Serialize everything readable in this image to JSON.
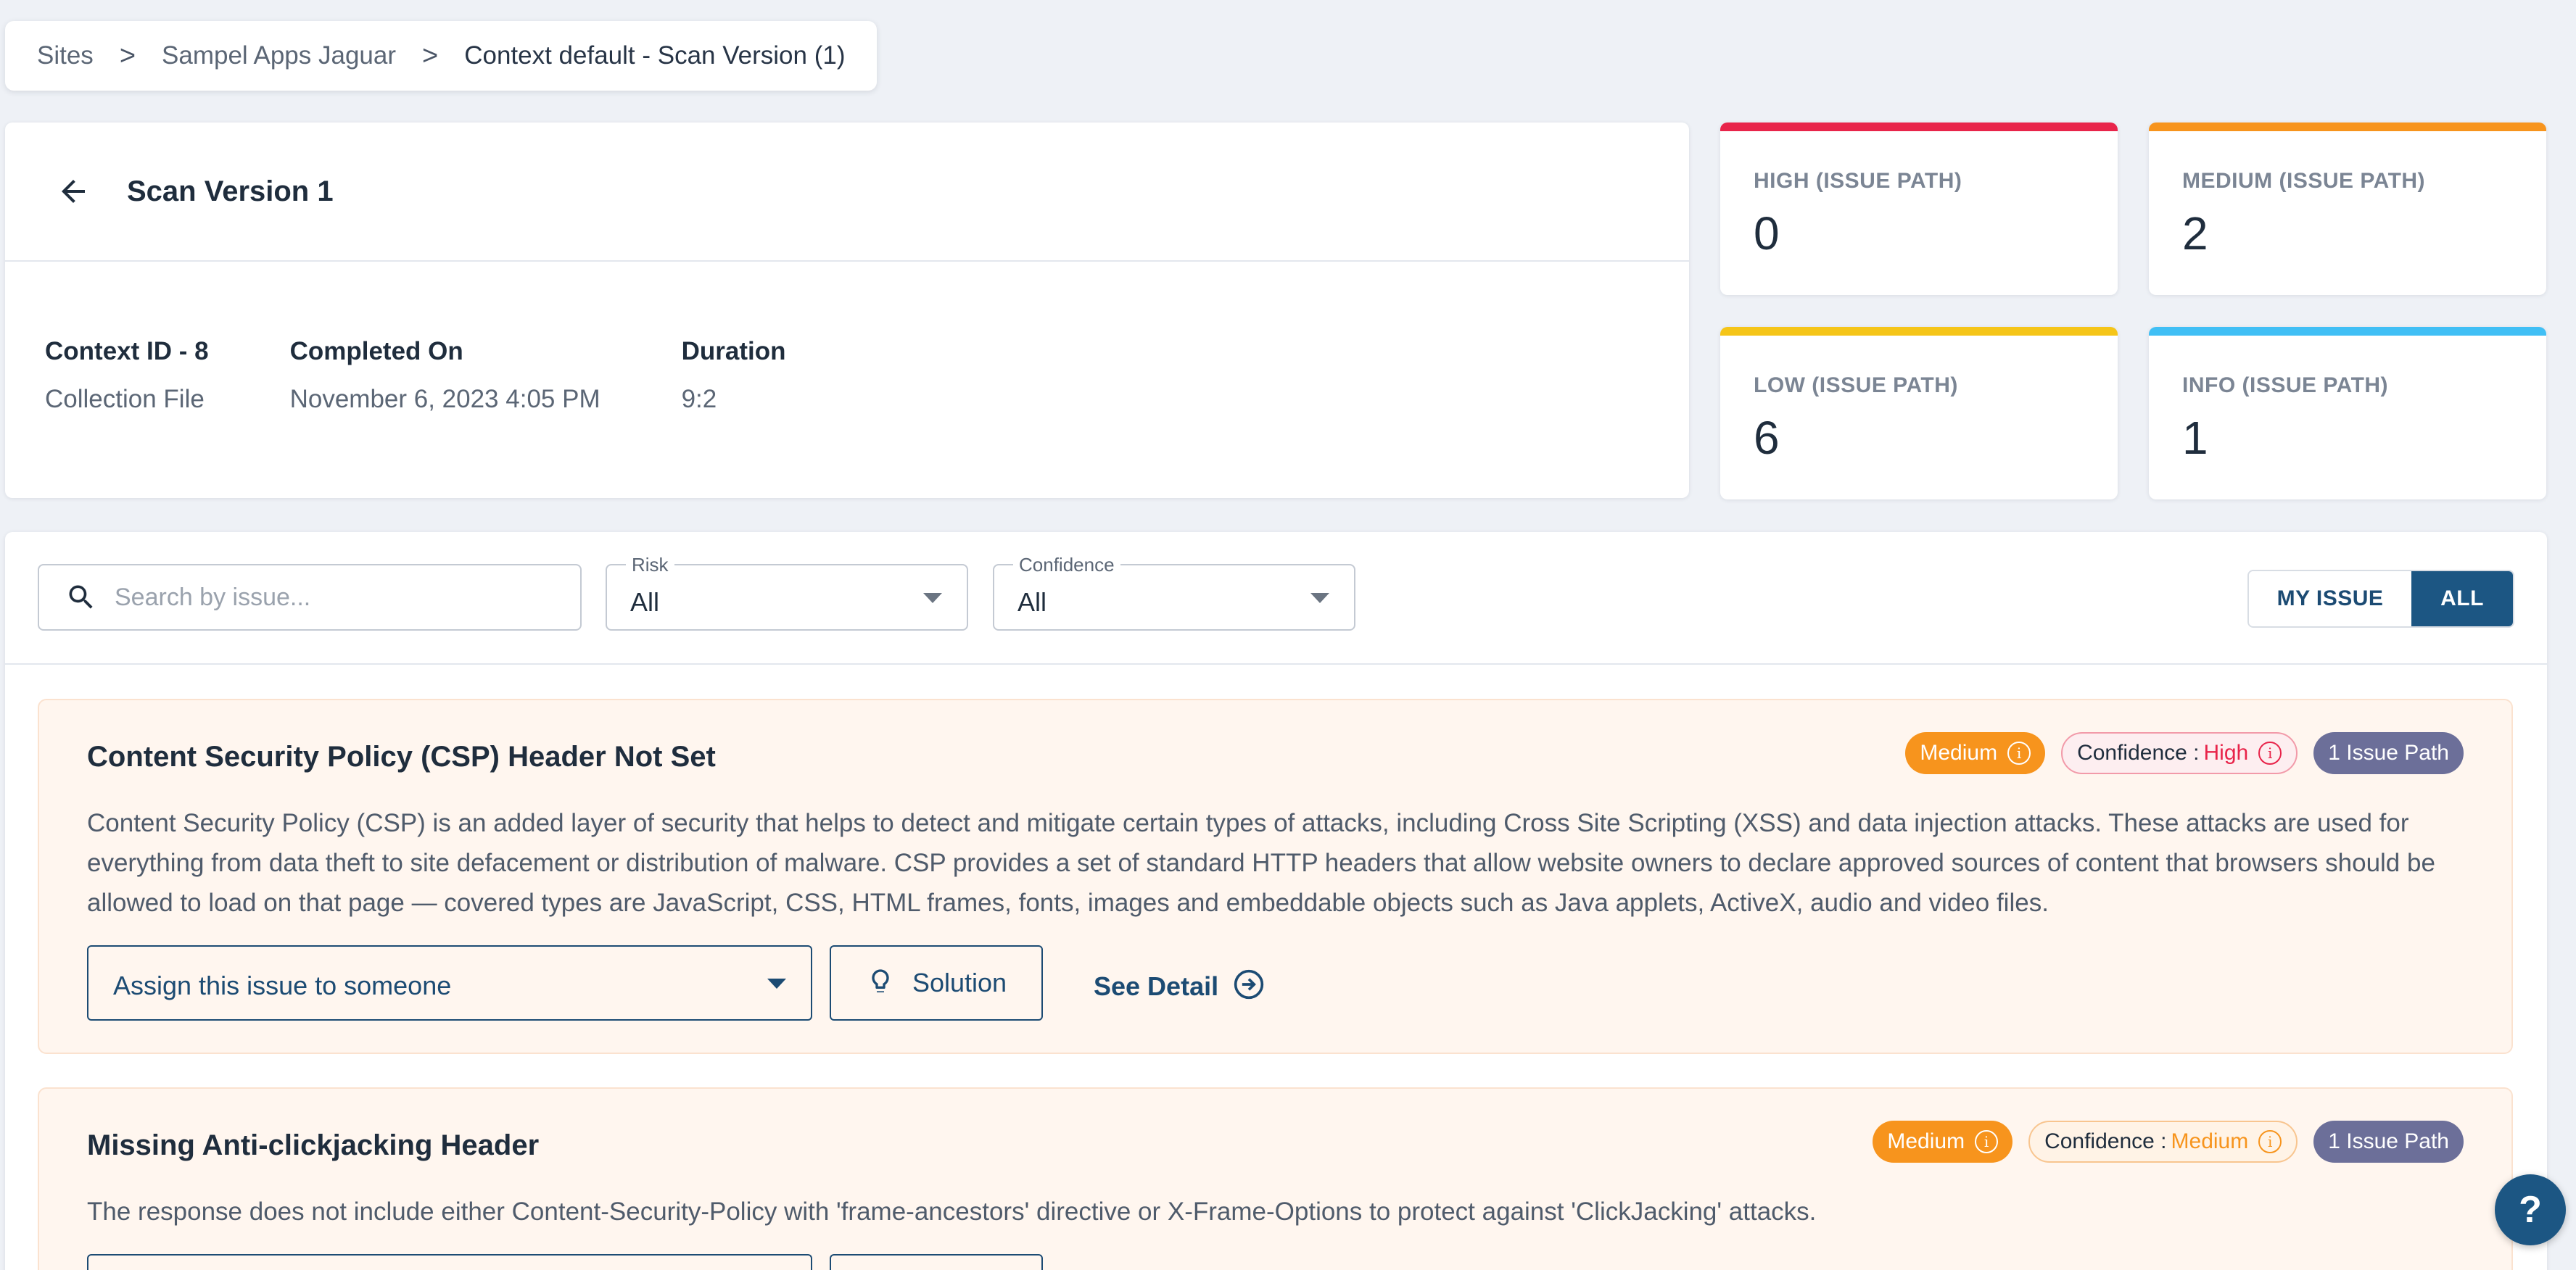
{
  "breadcrumb": {
    "items": [
      "Sites",
      "Sampel Apps Jaguar",
      "Context default - Scan Version (1)"
    ],
    "separator": ">"
  },
  "scan": {
    "title": "Scan Version 1",
    "context_label": "Context ID - 8",
    "context_value": "Collection File",
    "completed_label": "Completed On",
    "completed_value": "November 6, 2023 4:05 PM",
    "duration_label": "Duration",
    "duration_value": "9:2"
  },
  "stats": [
    {
      "label": "HIGH (ISSUE PATH)",
      "value": "0",
      "color": "#e8244a"
    },
    {
      "label": "MEDIUM (ISSUE PATH)",
      "value": "2",
      "color": "#f7941d"
    },
    {
      "label": "LOW (ISSUE PATH)",
      "value": "6",
      "color": "#f5c518"
    },
    {
      "label": "INFO (ISSUE PATH)",
      "value": "1",
      "color": "#40bff5"
    }
  ],
  "filters": {
    "search_placeholder": "Search by issue...",
    "risk_label": "Risk",
    "risk_value": "All",
    "confidence_label": "Confidence",
    "confidence_value": "All",
    "my_issue_label": "MY ISSUE",
    "all_label": "ALL"
  },
  "issues": [
    {
      "title": "Content Security Policy (CSP) Header Not Set",
      "risk": "Medium",
      "confidence_prefix": "Confidence : ",
      "confidence": "High",
      "confidence_color": "#e8244a",
      "issue_path": "1 Issue Path",
      "description": "Content Security Policy (CSP) is an added layer of security that helps to detect and mitigate certain types of attacks, including Cross Site Scripting (XSS) and data injection attacks. These attacks are used for everything from data theft to site defacement or distribution of malware. CSP provides a set of standard HTTP headers that allow website owners to declare approved sources of content that browsers should be allowed to load on that page — covered types are JavaScript, CSS, HTML frames, fonts, images and embeddable objects such as Java applets, ActiveX, audio and video files.",
      "assign_placeholder": "Assign this issue to someone",
      "solution_label": "Solution",
      "see_detail_label": "See Detail"
    },
    {
      "title": "Missing Anti-clickjacking Header",
      "risk": "Medium",
      "confidence_prefix": "Confidence : ",
      "confidence": "Medium",
      "confidence_color": "#f7941d",
      "issue_path": "1 Issue Path",
      "description": "The response does not include either Content-Security-Policy with 'frame-ancestors' directive or X-Frame-Options to protect against 'ClickJacking' attacks."
    }
  ],
  "help": {
    "label": "?"
  }
}
